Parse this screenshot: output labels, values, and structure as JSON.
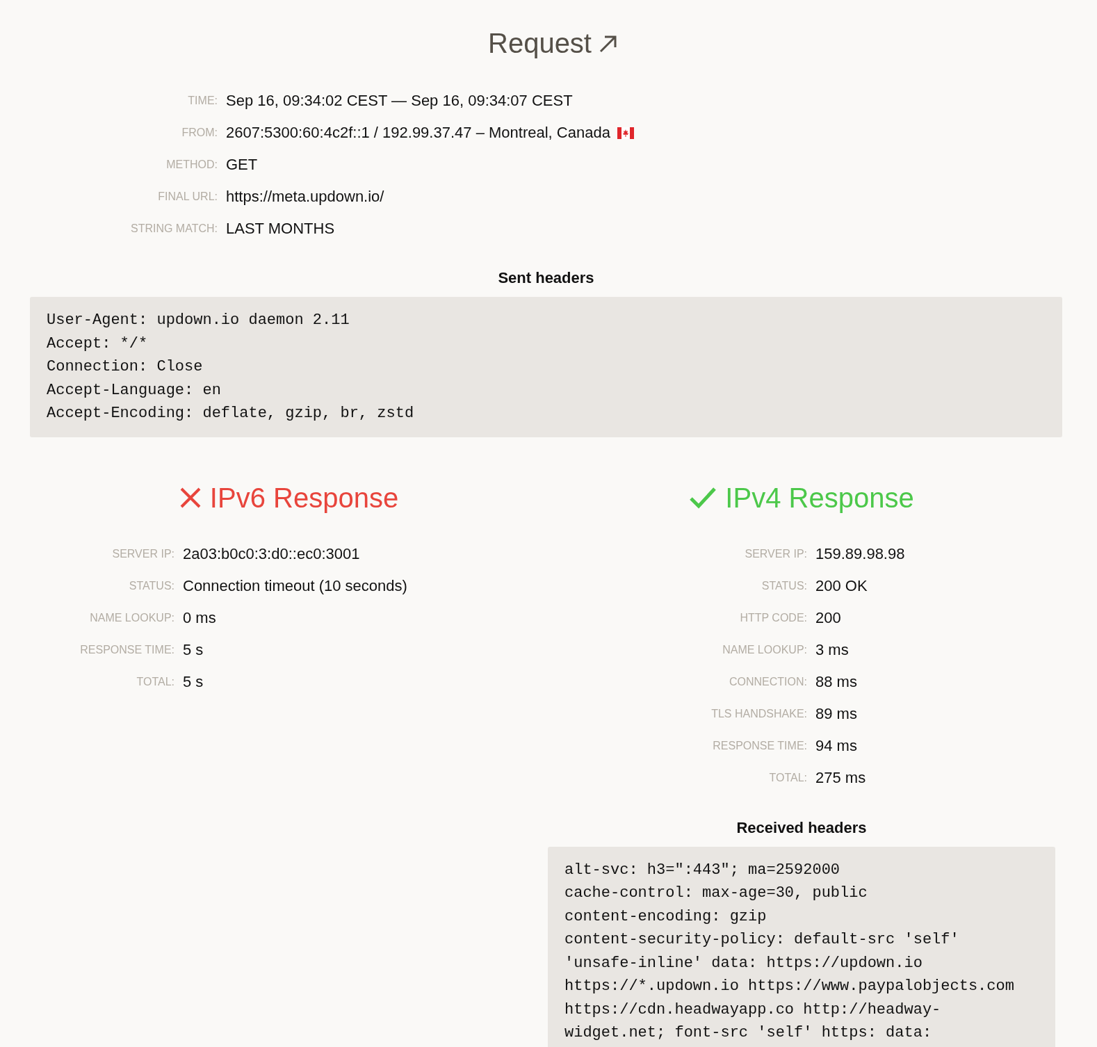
{
  "title": "Request",
  "request_fields": [
    {
      "label": "TIME:",
      "value": "Sep 16, 09:34:02 CEST — Sep 16, 09:34:07 CEST"
    },
    {
      "label": "FROM:",
      "value": "2607:5300:60:4c2f::1 / 192.99.37.47 – Montreal, Canada",
      "flag": true
    },
    {
      "label": "METHOD:",
      "value": "GET"
    },
    {
      "label": "FINAL URL:",
      "value": "https://meta.updown.io/"
    },
    {
      "label": "STRING MATCH:",
      "value": "LAST MONTHS"
    }
  ],
  "sent_headers": {
    "title": "Sent headers",
    "lines": [
      "User-Agent: updown.io daemon 2.11",
      "Accept: */*",
      "Connection: Close",
      "Accept-Language: en",
      "Accept-Encoding: deflate, gzip, br, zstd"
    ]
  },
  "responses": [
    {
      "title": "IPv6 Response",
      "kind": "fail",
      "fields": [
        {
          "label": "SERVER IP:",
          "value": "2a03:b0c0:3:d0::ec0:3001"
        },
        {
          "label": "STATUS:",
          "value": "Connection timeout (10 seconds)"
        },
        {
          "label": "NAME LOOKUP:",
          "value": "0 ms"
        },
        {
          "label": "RESPONSE TIME:",
          "value": "5 s"
        },
        {
          "label": "TOTAL:",
          "value": "5 s"
        }
      ]
    },
    {
      "title": "IPv4 Response",
      "kind": "ok",
      "fields": [
        {
          "label": "SERVER IP:",
          "value": "159.89.98.98"
        },
        {
          "label": "STATUS:",
          "value": "200 OK"
        },
        {
          "label": "HTTP CODE:",
          "value": "200"
        },
        {
          "label": "NAME LOOKUP:",
          "value": "3 ms"
        },
        {
          "label": "CONNECTION:",
          "value": "88 ms"
        },
        {
          "label": "TLS HANDSHAKE:",
          "value": "89 ms"
        },
        {
          "label": "RESPONSE TIME:",
          "value": "94 ms"
        },
        {
          "label": "TOTAL:",
          "value": "275 ms"
        }
      ],
      "received_headers": {
        "title": "Received headers",
        "lines": [
          "alt-svc: h3=\":443\"; ma=2592000",
          "cache-control: max-age=30, public",
          "content-encoding: gzip",
          "content-security-policy: default-src 'self'",
          "'unsafe-inline' data: https://updown.io",
          "https://*.updown.io https://www.paypalobjects.com",
          "https://cdn.headwayapp.co http://headway-",
          "widget.net; font-src 'self' https: data:"
        ]
      }
    }
  ]
}
